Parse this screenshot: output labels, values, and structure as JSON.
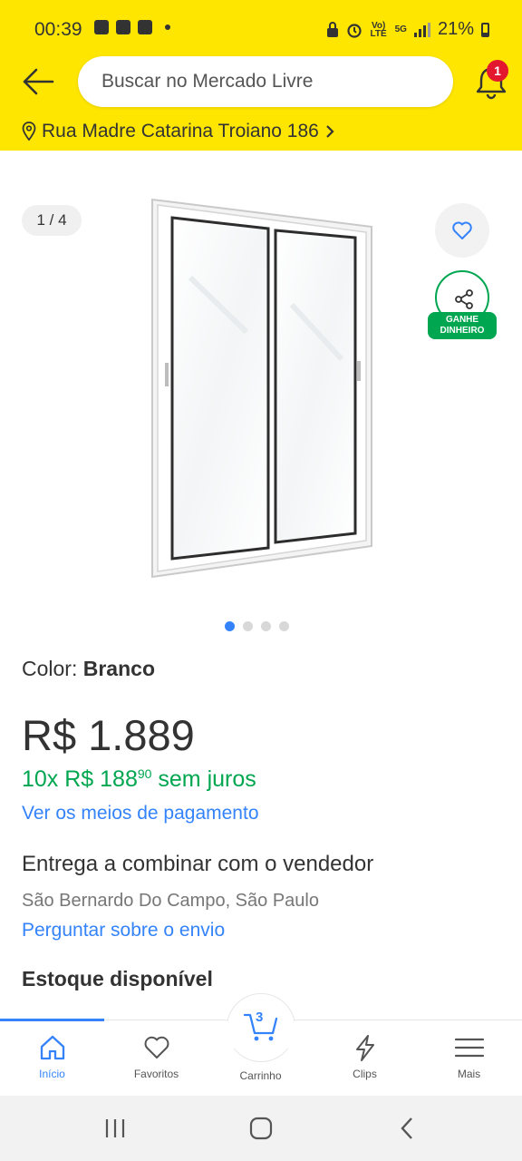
{
  "status_bar": {
    "time": "00:39",
    "network": "Vo) LTE",
    "data": "5G",
    "battery": "21%"
  },
  "header": {
    "search_placeholder": "Buscar no Mercado Livre",
    "notification_count": "1",
    "address": "Rua Madre Catarina Troiano 186",
    "colors": {
      "background": "#ffe600",
      "badge": "#e3172e"
    }
  },
  "gallery": {
    "counter": "1 / 4",
    "current_image": 1,
    "total_images": 4,
    "share_label_1": "GANHE",
    "share_label_2": "DINHEIRO"
  },
  "product": {
    "color_label": "Color:",
    "color_value": "Branco",
    "price": "R$ 1.889",
    "installments_prefix": "10x R$ 188",
    "installments_cents": "90",
    "installments_suffix": "sem juros",
    "payment_link": "Ver os meios de pagamento",
    "delivery": "Entrega a combinar com o vendedor",
    "location": "São Bernardo Do Campo, São Paulo",
    "shipping_link": "Perguntar sobre o envio",
    "stock": "Estoque disponível"
  },
  "bottom_nav": {
    "items": [
      {
        "label": "Início",
        "icon": "home-icon",
        "active": true
      },
      {
        "label": "Favoritos",
        "icon": "heart-icon",
        "active": false
      },
      {
        "label": "Carrinho",
        "icon": "cart-icon",
        "active": false
      },
      {
        "label": "Clips",
        "icon": "clips-icon",
        "active": false
      },
      {
        "label": "Mais",
        "icon": "menu-icon",
        "active": false
      }
    ],
    "cart_count": "3",
    "accent": "#3483fa"
  },
  "colors": {
    "green": "#00a650",
    "link": "#3483fa"
  }
}
